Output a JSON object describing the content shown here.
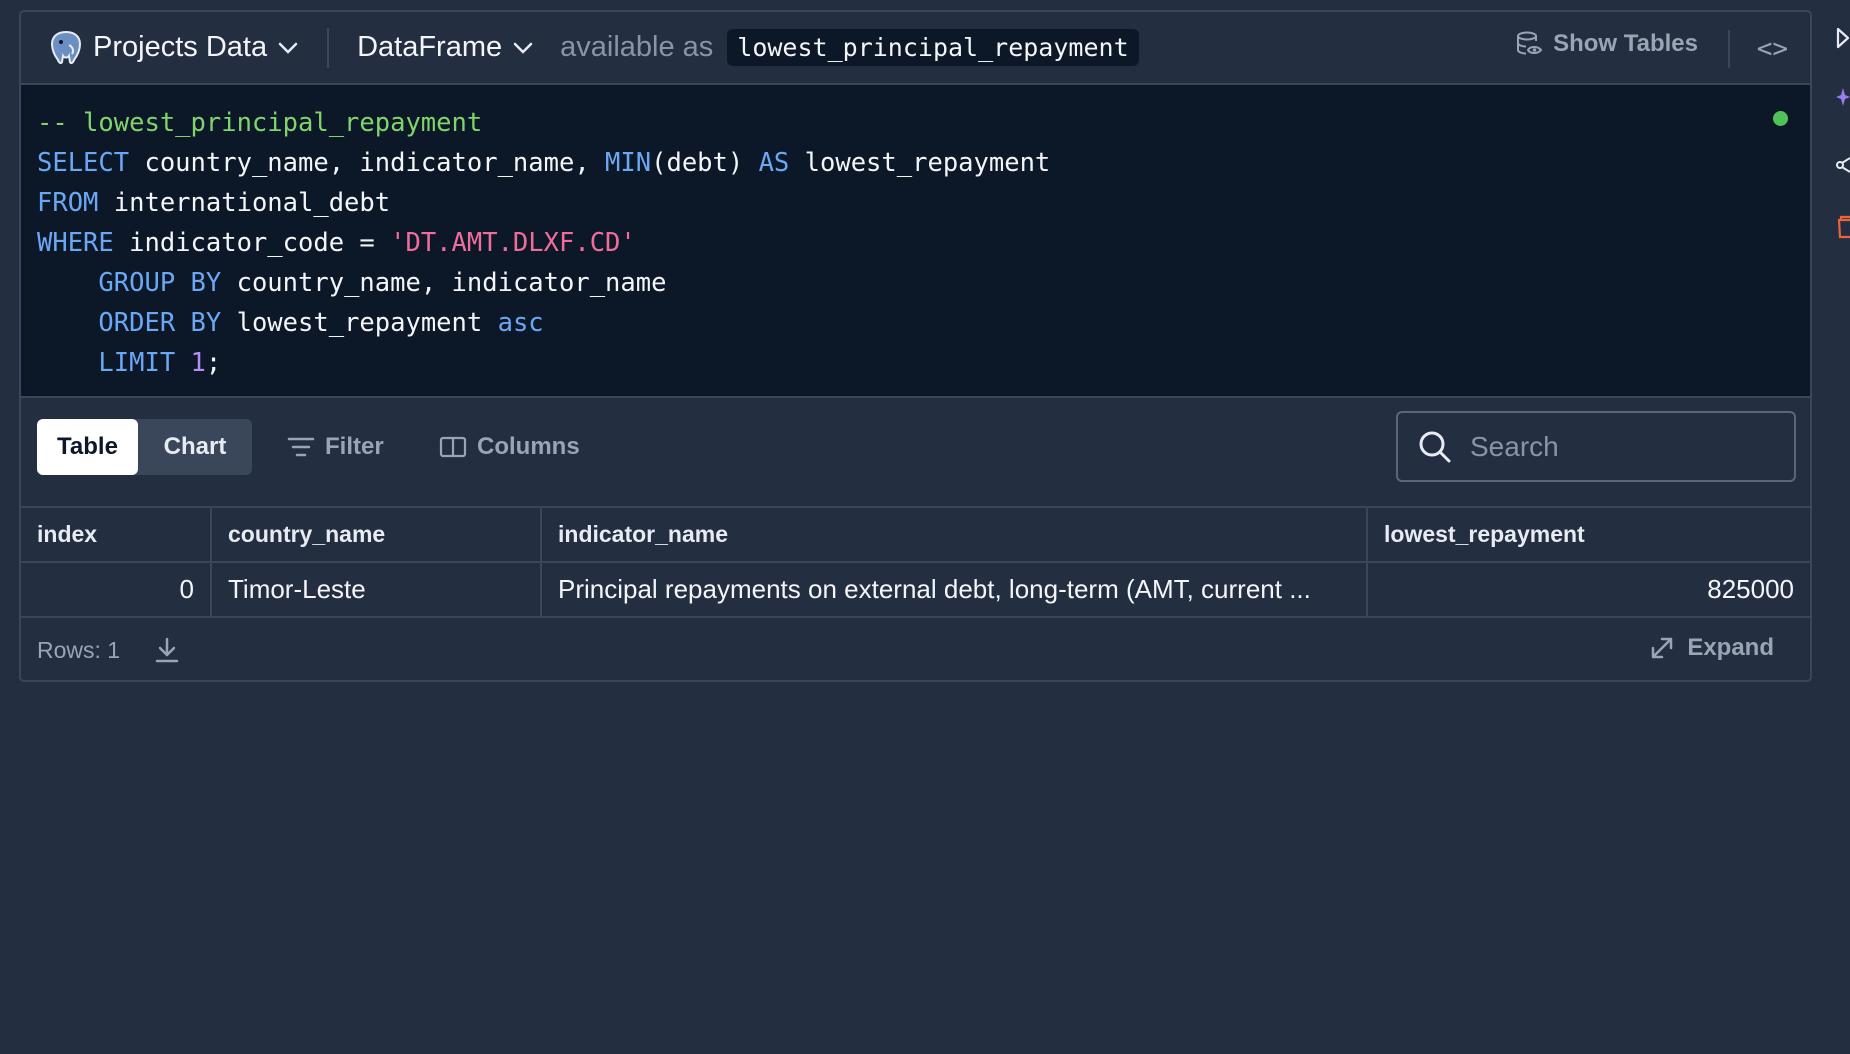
{
  "header": {
    "db_label": "Projects Data",
    "output_type": "DataFrame",
    "available_text": "available as",
    "variable_name": "lowest_principal_repayment",
    "show_tables": "Show Tables",
    "code_toggle": "<>"
  },
  "editor": {
    "lines": [
      [
        {
          "t": "cm",
          "v": "-- lowest_principal_repayment"
        }
      ],
      [
        {
          "t": "kw",
          "v": "SELECT"
        },
        {
          "t": "",
          "v": " country_name, indicator_name, "
        },
        {
          "t": "kw",
          "v": "MIN"
        },
        {
          "t": "",
          "v": "(debt) "
        },
        {
          "t": "kw",
          "v": "AS"
        },
        {
          "t": "",
          "v": " lowest_repayment"
        }
      ],
      [
        {
          "t": "kw",
          "v": "FROM"
        },
        {
          "t": "",
          "v": " international_debt"
        }
      ],
      [
        {
          "t": "kw",
          "v": "WHERE"
        },
        {
          "t": "",
          "v": " indicator_code = "
        },
        {
          "t": "str",
          "v": "'DT.AMT.DLXF.CD'"
        }
      ],
      [
        {
          "t": "",
          "v": "    "
        },
        {
          "t": "kw",
          "v": "GROUP BY"
        },
        {
          "t": "",
          "v": " country_name, indicator_name"
        }
      ],
      [
        {
          "t": "",
          "v": "    "
        },
        {
          "t": "kw",
          "v": "ORDER BY"
        },
        {
          "t": "",
          "v": " lowest_repayment "
        },
        {
          "t": "kw",
          "v": "asc"
        }
      ],
      [
        {
          "t": "",
          "v": "    "
        },
        {
          "t": "kw",
          "v": "LIMIT"
        },
        {
          "t": "",
          "v": " "
        },
        {
          "t": "num",
          "v": "1"
        },
        {
          "t": "",
          "v": ";"
        }
      ]
    ],
    "status_color": "#4fc25a"
  },
  "toolbar": {
    "tab_table": "Table",
    "tab_chart": "Chart",
    "active_tab": "Table",
    "filter_label": "Filter",
    "columns_label": "Columns",
    "search_placeholder": "Search",
    "search_value": ""
  },
  "table": {
    "columns": [
      "index",
      "country_name",
      "indicator_name",
      "lowest_repayment"
    ],
    "rows": [
      [
        "0",
        "Timor-Leste",
        "Principal repayments on external debt, long-term (AMT, current ...",
        "825000"
      ]
    ]
  },
  "footer": {
    "rows_label": "Rows: 1",
    "expand_label": "Expand"
  },
  "side_actions": [
    "run-icon",
    "ai-sparkle-icon",
    "share-icon",
    "delete-icon"
  ],
  "colors": {
    "background": "#232e41",
    "editor_bg": "#0c1828",
    "keyword": "#6aa8f5",
    "comment": "#7fd46a",
    "string": "#f06c9b",
    "number": "#b48ff3",
    "delete_accent": "#e8643c",
    "ai_accent": "#9b7bf0"
  }
}
